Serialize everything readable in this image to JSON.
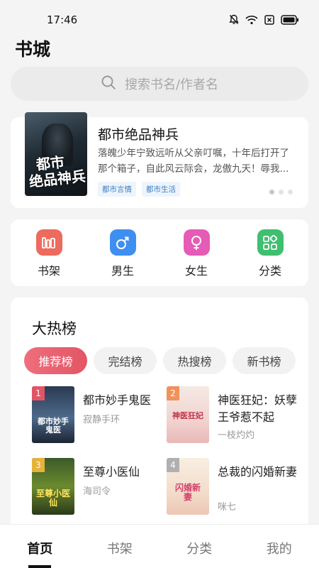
{
  "status_bar": {
    "time": "17:46"
  },
  "page_title": "书城",
  "search": {
    "placeholder": "搜索书名/作者名"
  },
  "banner": {
    "title": "都市绝品神兵",
    "description": "落魄少年宁致远听从父亲叮嘱，十年后打开了那个箱子，自此风云际会，龙傲九天！辱我...",
    "tags": [
      "都市言情",
      "都市生活"
    ],
    "cover_text": [
      "都市",
      "绝品神兵"
    ]
  },
  "quick_entries": [
    {
      "label": "书架",
      "icon": "bookshelf-icon",
      "color": "#ec6b5e"
    },
    {
      "label": "男生",
      "icon": "male-icon",
      "color": "#3f8ff0"
    },
    {
      "label": "女生",
      "icon": "female-icon",
      "color": "#e55bb6"
    },
    {
      "label": "分类",
      "icon": "category-icon",
      "color": "#3fbf6f"
    }
  ],
  "rank": {
    "title": "大热榜",
    "tabs": [
      "推荐榜",
      "完结榜",
      "热搜榜",
      "新书榜"
    ],
    "active_tab": "推荐榜",
    "books": [
      {
        "rank": "1",
        "title": "都市妙手鬼医",
        "author": "寂静手环",
        "cover_text": "都市妙手鬼医"
      },
      {
        "rank": "2",
        "title": "神医狂妃：妖孽王爷惹不起",
        "author": "一枝灼灼",
        "cover_text": "神医狂妃"
      },
      {
        "rank": "3",
        "title": "至尊小医仙",
        "author": "海司令",
        "cover_text": "至尊小医仙"
      },
      {
        "rank": "4",
        "title": "总裁的闪婚新妻",
        "author": "咪七",
        "cover_text": "闪婚新妻"
      }
    ]
  },
  "bottom_nav": [
    "首页",
    "书架",
    "分类",
    "我的"
  ],
  "colors": {
    "accent": "#e25565",
    "tag_text": "#3b7fc4"
  }
}
